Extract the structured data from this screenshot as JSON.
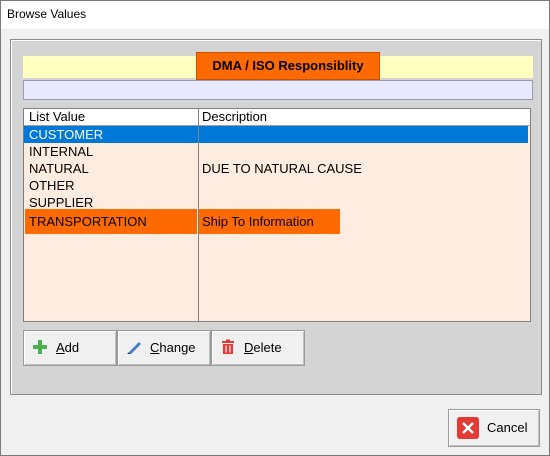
{
  "window": {
    "title": "Browse Values"
  },
  "header": {
    "title": "DMA / ISO Responsiblity"
  },
  "list": {
    "columns": [
      "List Value",
      "Description"
    ],
    "rows": [
      {
        "value": "CUSTOMER",
        "description": "",
        "selected": true
      },
      {
        "value": "INTERNAL",
        "description": ""
      },
      {
        "value": "NATURAL",
        "description": "DUE TO NATURAL CAUSE"
      },
      {
        "value": "OTHER",
        "description": ""
      },
      {
        "value": "SUPPLIER",
        "description": ""
      },
      {
        "value": "TRANSPORTATION",
        "description": "Ship To Information",
        "highlighted": true
      }
    ]
  },
  "buttons": {
    "add": {
      "label_first": "A",
      "label_rest": "dd",
      "icon": "plus-icon"
    },
    "change": {
      "label_first": "C",
      "label_rest": "hange",
      "icon": "pencil-icon"
    },
    "delete": {
      "label_first": "D",
      "label_rest": "elete",
      "icon": "trash-icon"
    },
    "cancel": {
      "label": "Cancel",
      "icon": "close-icon"
    }
  },
  "colors": {
    "accent": "#ff6a00",
    "selection": "#0078d7",
    "list_bg": "#ffece0"
  }
}
